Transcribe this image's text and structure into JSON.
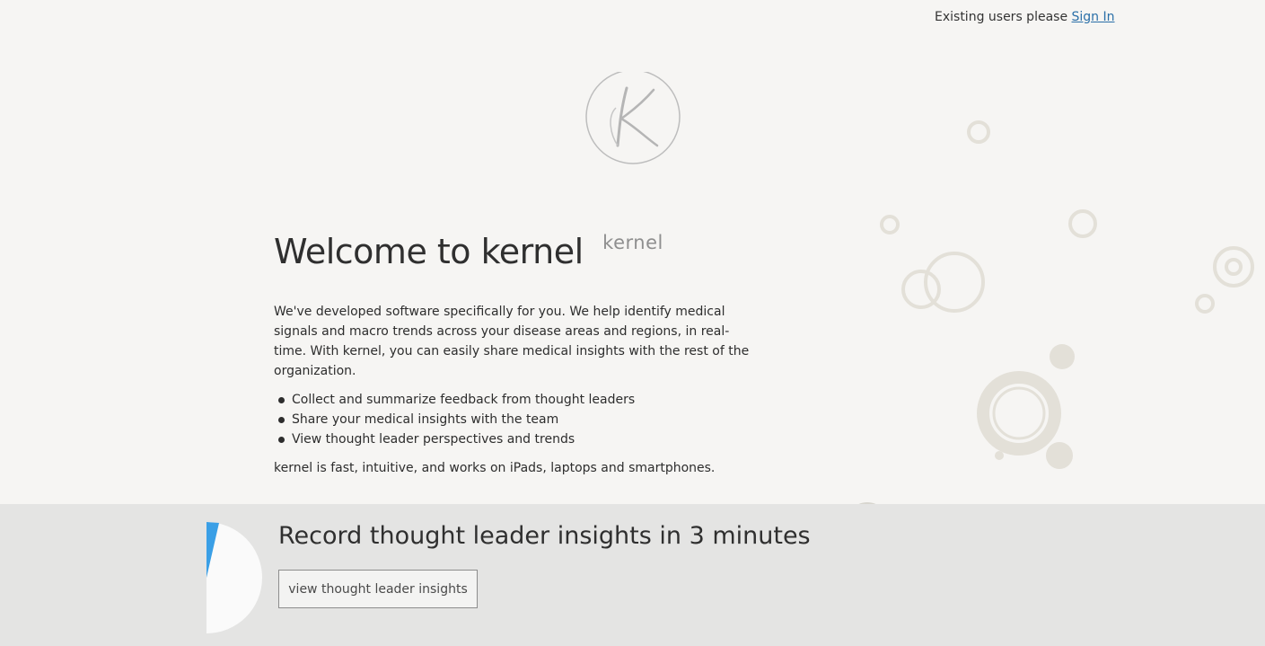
{
  "header": {
    "existing_users_text": "Existing users please",
    "sign_in_label": "Sign In"
  },
  "logo": {
    "letter": "K",
    "word": "kernel"
  },
  "main": {
    "title": "Welcome to kernel",
    "intro": "We've developed software specifically for you. We help identify medical signals and macro trends across your disease areas and regions, in real-time. With kernel, you can easily share medical insights with the rest of the organization.",
    "features": [
      "Collect and summarize feedback from thought leaders",
      "Share your medical insights with the team",
      "View thought leader perspectives and trends"
    ],
    "tagline": "kernel is fast, intuitive, and works on iPads, laptops and smartphones."
  },
  "band": {
    "title": "Record thought leader insights in 3 minutes",
    "button_label": "view thought leader insights"
  },
  "colors": {
    "background": "#f6f5f3",
    "band": "#e4e4e3",
    "link": "#2a6fa8",
    "pie_accent": "#3a9fe6",
    "decor": "#e0ddd5"
  }
}
